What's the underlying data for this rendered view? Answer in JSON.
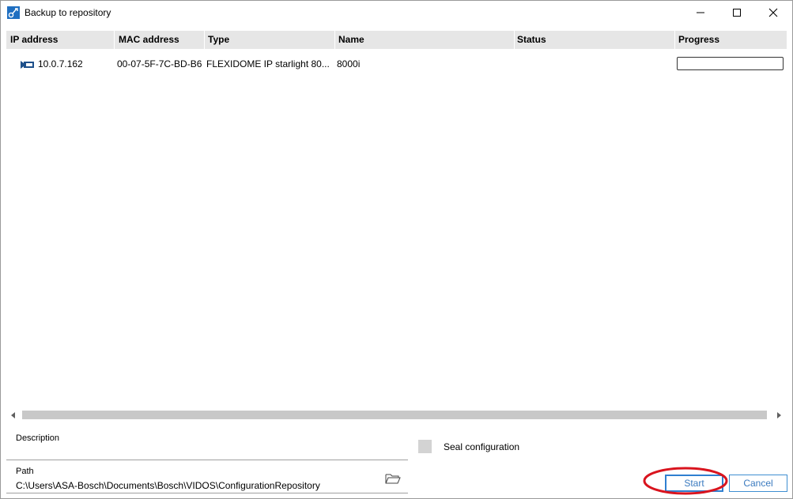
{
  "window": {
    "title": "Backup to repository",
    "controls": {
      "minimize_icon": "minimize-icon",
      "maximize_icon": "maximize-icon",
      "close_icon": "close-icon"
    }
  },
  "table": {
    "columns": [
      "IP address",
      "MAC address",
      "Type",
      "Name",
      "Status",
      "Progress"
    ],
    "rows": [
      {
        "icon": "camera-device-icon",
        "ip": "10.0.7.162",
        "mac": "00-07-5F-7C-BD-B6",
        "type": "FLEXIDOME IP starlight 80...",
        "name": "8000i",
        "status": "",
        "progress": 0
      }
    ]
  },
  "form": {
    "description_label": "Description",
    "description_value": "",
    "path_label": "Path",
    "path_value": "C:\\Users\\ASA-Bosch\\Documents\\Bosch\\VIDOS\\ConfigurationRepository",
    "seal_label": "Seal configuration",
    "seal_checked": false
  },
  "buttons": {
    "start": "Start",
    "cancel": "Cancel"
  },
  "colors": {
    "accent": "#3a7abf",
    "header_bg": "#e6e6e6",
    "annotation": "#d9141e"
  }
}
